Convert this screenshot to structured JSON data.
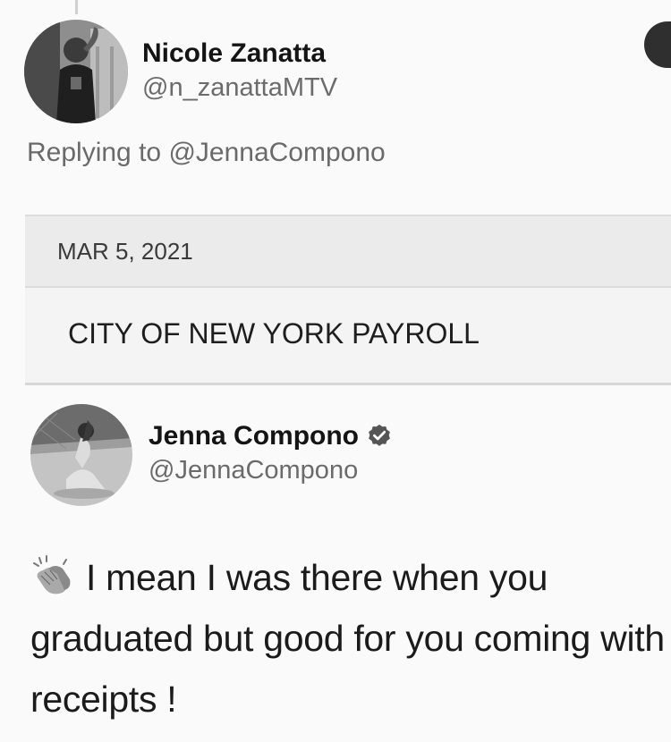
{
  "tweet_reply": {
    "author": {
      "display_name": "Nicole Zanatta",
      "handle": "@n_zanattaMTV",
      "avatar_icon": "profile-photo"
    },
    "replying_label": "Replying to",
    "replying_to": "@JennaCompono"
  },
  "receipt": {
    "date": "MAR 5, 2021",
    "payee": "CITY OF NEW YORK PAYROLL"
  },
  "quoted_tweet": {
    "author": {
      "display_name": "Jenna Compono",
      "handle": "@JennaCompono",
      "verified": true,
      "verified_icon": "verified-badge-icon",
      "avatar_icon": "profile-photo"
    },
    "emoji_icon": "clapping-hands-icon",
    "text": "I mean I was there when you graduated but good for you coming with receipts !"
  },
  "colors": {
    "background": "#fafafa",
    "text": "#1b1b1b",
    "secondary_text": "#6b6b6b",
    "receipt_band": "#ebebeb"
  }
}
